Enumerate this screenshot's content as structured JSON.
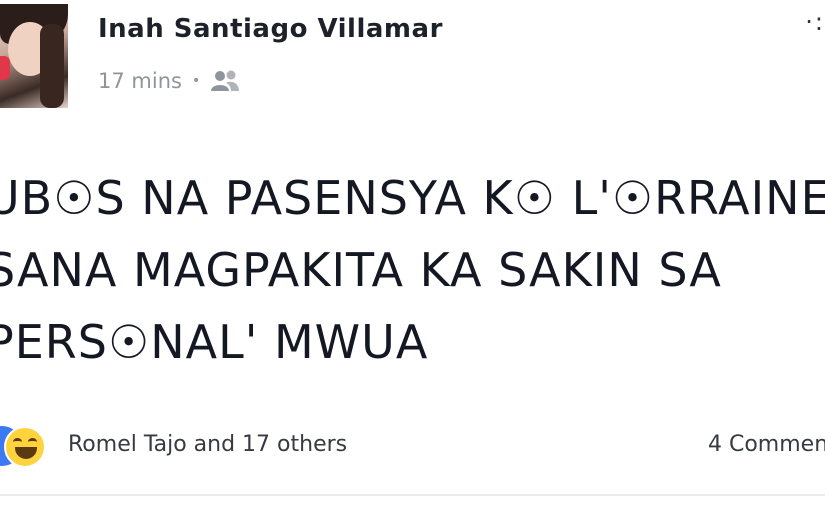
{
  "post": {
    "author": "Inah Santiago Villamar",
    "time": "17 mins",
    "separator": "•",
    "audience_icon": "friends-icon",
    "more_icon": "ellipsis-icon",
    "more_label": "·:",
    "lines": [
      "UB☉S NA PASENSYA K☉ L'☉RRAINE",
      "SANA MAGPAKITA KA SAKIN SA",
      "PERS☉NAL' MWUA"
    ]
  },
  "reactions": {
    "icons": [
      "like-icon",
      "haha-icon"
    ],
    "colors": {
      "like": "#3b7af2",
      "haha": "#ffd33d"
    },
    "summary": "Romel Tajo and 17 others",
    "comments": "4 Commen"
  }
}
